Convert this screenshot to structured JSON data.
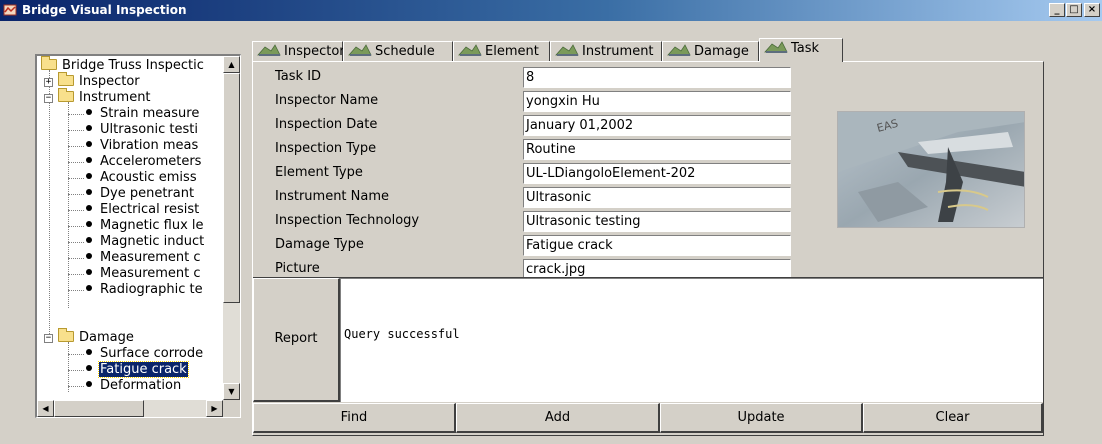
{
  "window": {
    "title": "Bridge Visual Inspection",
    "min": "_",
    "max": "□",
    "close": "×"
  },
  "tree": {
    "root": "Bridge Truss Inspectic",
    "inspector": "Inspector",
    "instrument": "Instrument",
    "instrument_items": [
      "Strain measure",
      "Ultrasonic testi",
      "Vibration meas",
      "Accelerometers",
      "Acoustic emiss",
      "Dye penetrant",
      "Electrical resist",
      "Magnetic flux le",
      "Magnetic induct",
      "Measurement c",
      "Measurement c",
      "Radiographic te"
    ],
    "damage": "Damage",
    "damage_items": [
      "Surface corrode",
      "Fatigue crack",
      "Deformation"
    ],
    "expand_plus": "+",
    "expand_minus": "−"
  },
  "tabs": [
    "Inspector",
    "Schedule",
    "Element",
    "Instrument",
    "Damage",
    "Task"
  ],
  "active_tab": "Task",
  "fields": [
    {
      "label": "Task ID",
      "value": "8"
    },
    {
      "label": "Inspector Name",
      "value": "yongxin Hu"
    },
    {
      "label": "Inspection Date",
      "value": "January 01,2002"
    },
    {
      "label": "Inspection Type",
      "value": "Routine"
    },
    {
      "label": "Element Type",
      "value": "UL-LDiangoloElement-202"
    },
    {
      "label": "Instrument Name",
      "value": "Ultrasonic"
    },
    {
      "label": "Inspection Technology",
      "value": "Ultrasonic testing"
    },
    {
      "label": "Damage Type",
      "value": "Fatigue crack"
    },
    {
      "label": "Picture",
      "value": "crack.jpg"
    }
  ],
  "report": {
    "button": "Report",
    "text": "Query successful"
  },
  "buttons": {
    "find": "Find",
    "add": "Add",
    "update": "Update",
    "clear": "Clear"
  },
  "colors": {
    "titlebar_start": "#0a246a",
    "titlebar_end": "#a6caf0",
    "selection": "#0a246a",
    "face": "#d4d0c8"
  }
}
